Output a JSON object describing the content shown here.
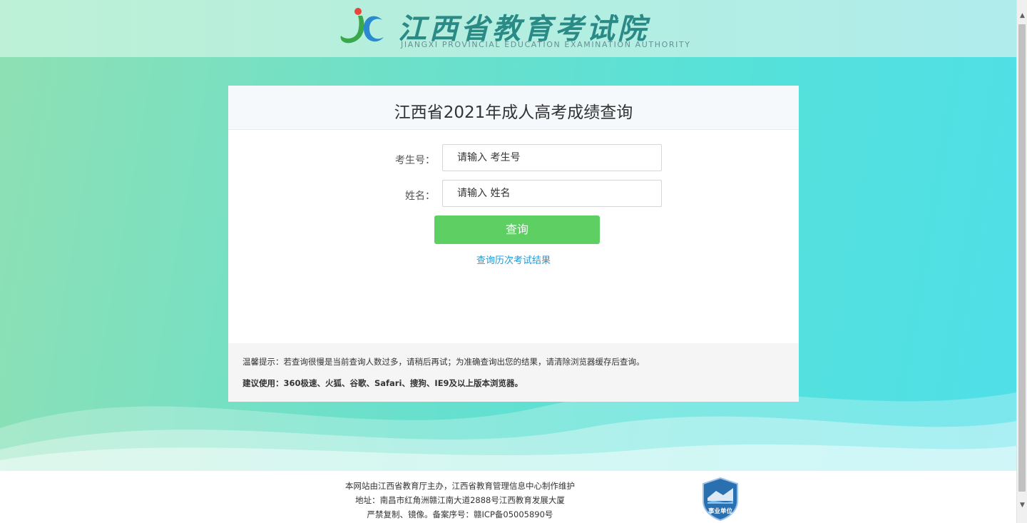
{
  "header": {
    "logo_title": "江西省教育考试院",
    "logo_subtitle": "JIANGXI PROVINCIAL EDUCATION EXAMINATION AUTHORITY"
  },
  "form": {
    "title": "江西省2021年成人高考成绩查询",
    "exam_id_label": "考生号：",
    "exam_id_placeholder": "请输入 考生号",
    "name_label": "姓名：",
    "name_placeholder": "请输入 姓名",
    "submit_label": "查询",
    "history_link": "查询历次考试结果"
  },
  "tips": {
    "notice": "温馨提示：若查询很慢是当前查询人数过多，请稍后再试；为准确查询出您的结果，请清除浏览器缓存后查询。",
    "browsers": "建议使用：360极速、火狐、谷歌、Safari、搜狗、IE9及以上版本浏览器。"
  },
  "footer": {
    "line1": "本网站由江西省教育厅主办，江西省教育管理信息中心制作维护",
    "line2": "地址：南昌市红角洲赣江南大道2888号江西教育发展大厦",
    "line3": "严禁复制、镜像。备案序号：赣ICP备05005890号",
    "badge_label": "事业单位"
  },
  "colors": {
    "accent_button": "#5ecf63",
    "link": "#1e9ad6",
    "brand": "#2a8a86"
  }
}
